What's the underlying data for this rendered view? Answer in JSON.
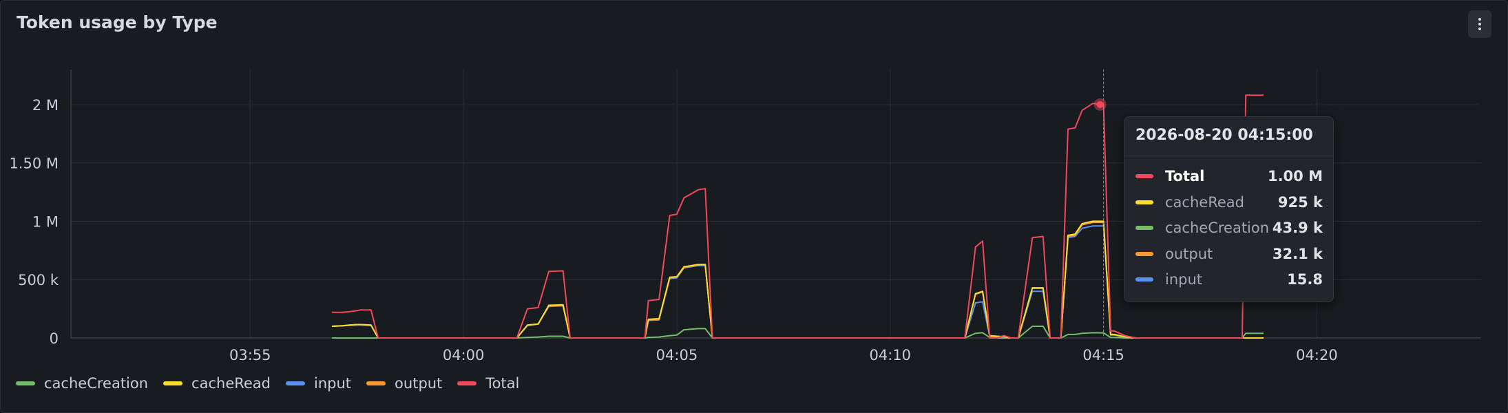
{
  "panel": {
    "title": "Token usage by Type"
  },
  "colors": {
    "cacheCreation": "#73bf69",
    "cacheRead": "#fade2a",
    "input": "#5794f2",
    "output": "#ff9830",
    "Total": "#f2495c"
  },
  "icons": {
    "menu": "kebab-menu-icon"
  },
  "chart_data": {
    "type": "line",
    "title": "Token usage by Type",
    "xlabel": "",
    "ylabel": "",
    "x_ticks": [
      "03:55",
      "04:00",
      "04:05",
      "04:10",
      "04:15",
      "04:20"
    ],
    "y_ticks": [
      "0",
      "500 k",
      "1 M",
      "1.50 M",
      "2 M"
    ],
    "xlim": [
      "03:50:48",
      "04:23:51"
    ],
    "ylim": [
      0,
      2300000
    ],
    "grid": true,
    "legend_position": "bottom-left",
    "x": [
      "03:56:55",
      "03:57:10",
      "03:57:20",
      "03:57:30",
      "03:57:35",
      "03:57:50",
      "03:58:00",
      "03:58:20",
      "03:59:00",
      "04:00:00",
      "04:01:00",
      "04:01:15",
      "04:01:30",
      "04:01:45",
      "04:02:00",
      "04:02:20",
      "04:02:30",
      "04:02:45",
      "04:03:00",
      "04:04:00",
      "04:04:15",
      "04:04:20",
      "04:04:35",
      "04:04:50",
      "04:05:00",
      "04:05:10",
      "04:05:30",
      "04:05:40",
      "04:05:50",
      "04:06:00",
      "04:06:10",
      "04:06:20",
      "04:07:00",
      "04:08:00",
      "04:09:00",
      "04:10:00",
      "04:11:00",
      "04:11:45",
      "04:12:00",
      "04:12:10",
      "04:12:20",
      "04:12:30",
      "04:12:40",
      "04:12:50",
      "04:13:00",
      "04:13:20",
      "04:13:35",
      "04:13:45",
      "04:14:00",
      "04:14:10",
      "04:14:20",
      "04:14:30",
      "04:14:45",
      "04:15:00",
      "04:15:10",
      "04:15:15",
      "04:15:30",
      "04:15:45",
      "04:16:00",
      "04:16:30",
      "04:17:00",
      "04:18:00",
      "04:18:15",
      "04:18:20",
      "04:18:30",
      "04:18:45"
    ],
    "series": [
      {
        "name": "Total",
        "values": [
          220000,
          220000,
          225000,
          235000,
          240000,
          240000,
          0,
          0,
          0,
          0,
          0,
          0,
          250000,
          260000,
          570000,
          575000,
          0,
          0,
          0,
          0,
          0,
          320000,
          330000,
          1050000,
          1060000,
          1200000,
          1270000,
          1280000,
          0,
          0,
          0,
          0,
          0,
          0,
          0,
          0,
          0,
          0,
          780000,
          830000,
          0,
          0,
          20000,
          0,
          0,
          860000,
          870000,
          0,
          0,
          1790000,
          1800000,
          1950000,
          2010000,
          2000000,
          60000,
          60000,
          20000,
          0,
          0,
          0,
          0,
          0,
          0,
          2080000,
          2080000,
          2080000
        ]
      },
      {
        "name": "cacheRead",
        "values": [
          100000,
          105000,
          110000,
          115000,
          115000,
          110000,
          0,
          0,
          0,
          0,
          0,
          0,
          110000,
          120000,
          280000,
          285000,
          0,
          0,
          0,
          0,
          0,
          160000,
          165000,
          520000,
          525000,
          610000,
          630000,
          630000,
          0,
          0,
          0,
          0,
          0,
          0,
          0,
          0,
          0,
          0,
          380000,
          400000,
          20000,
          15000,
          10000,
          0,
          0,
          430000,
          430000,
          0,
          0,
          880000,
          890000,
          980000,
          1000000,
          1000000,
          30000,
          30000,
          10000,
          0,
          0,
          0,
          0,
          0,
          0,
          0,
          0,
          0
        ]
      },
      {
        "name": "output",
        "values": [
          100000,
          105000,
          110000,
          115000,
          115000,
          110000,
          0,
          0,
          0,
          0,
          0,
          0,
          110000,
          120000,
          275000,
          280000,
          0,
          0,
          0,
          0,
          0,
          155000,
          160000,
          515000,
          520000,
          605000,
          625000,
          625000,
          0,
          0,
          0,
          0,
          0,
          0,
          0,
          0,
          0,
          0,
          375000,
          395000,
          20000,
          15000,
          10000,
          0,
          0,
          425000,
          425000,
          0,
          0,
          870000,
          880000,
          970000,
          990000,
          990000,
          30000,
          30000,
          10000,
          0,
          0,
          0,
          0,
          0,
          0,
          0,
          0,
          0
        ]
      },
      {
        "name": "input",
        "values": [
          100000,
          104000,
          108000,
          112000,
          112000,
          108000,
          0,
          0,
          0,
          0,
          0,
          0,
          108000,
          118000,
          270000,
          275000,
          0,
          0,
          0,
          0,
          0,
          150000,
          155000,
          510000,
          515000,
          600000,
          620000,
          620000,
          0,
          0,
          0,
          0,
          0,
          0,
          0,
          0,
          0,
          0,
          300000,
          310000,
          15000,
          10000,
          8000,
          0,
          0,
          400000,
          400000,
          0,
          0,
          860000,
          870000,
          940000,
          960000,
          960000,
          25000,
          25000,
          8000,
          0,
          0,
          0,
          0,
          0,
          0,
          0,
          0,
          0
        ]
      },
      {
        "name": "cacheCreation",
        "values": [
          0,
          0,
          0,
          0,
          0,
          0,
          0,
          0,
          0,
          0,
          0,
          0,
          5000,
          8000,
          15000,
          15000,
          0,
          0,
          0,
          0,
          0,
          5000,
          8000,
          20000,
          25000,
          70000,
          80000,
          80000,
          0,
          0,
          0,
          0,
          0,
          0,
          0,
          0,
          0,
          0,
          40000,
          45000,
          5000,
          0,
          0,
          0,
          0,
          100000,
          100000,
          0,
          0,
          30000,
          30000,
          40000,
          45000,
          43900,
          5000,
          5000,
          0,
          0,
          0,
          0,
          0,
          0,
          0,
          40000,
          40000,
          40000
        ]
      }
    ]
  },
  "tooltip": {
    "time": "2026-08-20 04:15:00",
    "rows": [
      {
        "label": "Total",
        "value": "1.00 M",
        "color": "#f2495c"
      },
      {
        "label": "cacheRead",
        "value": "925 k",
        "color": "#fade2a"
      },
      {
        "label": "cacheCreation",
        "value": "43.9 k",
        "color": "#73bf69"
      },
      {
        "label": "output",
        "value": "32.1 k",
        "color": "#ff9830"
      },
      {
        "label": "input",
        "value": "15.8",
        "color": "#5794f2"
      }
    ]
  },
  "legend": [
    {
      "label": "cacheCreation",
      "color": "#73bf69"
    },
    {
      "label": "cacheRead",
      "color": "#fade2a"
    },
    {
      "label": "input",
      "color": "#5794f2"
    },
    {
      "label": "output",
      "color": "#ff9830"
    },
    {
      "label": "Total",
      "color": "#f2495c"
    }
  ]
}
